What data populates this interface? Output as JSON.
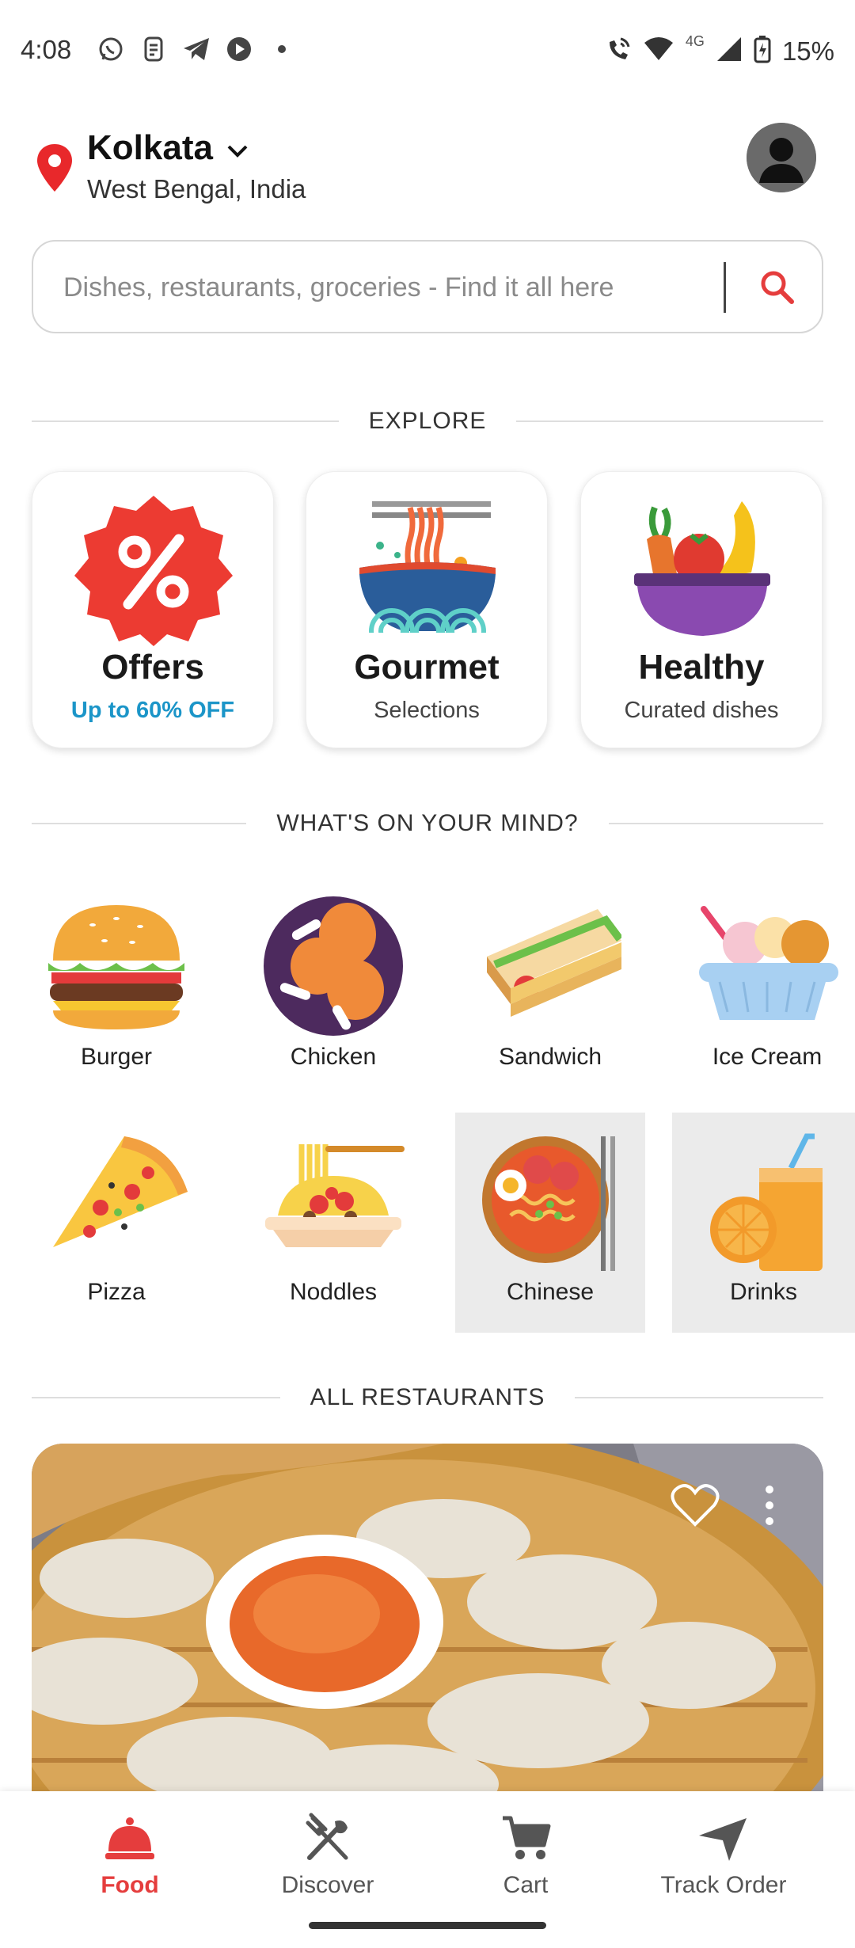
{
  "status_bar": {
    "time": "4:08",
    "network": "4G",
    "battery": "15%"
  },
  "header": {
    "city": "Kolkata",
    "region": "West Bengal, India"
  },
  "search": {
    "placeholder": "Dishes, restaurants, groceries - Find it all here"
  },
  "explore": {
    "heading": "EXPLORE",
    "cards": [
      {
        "title": "Offers",
        "subtitle": "Up to 60% OFF"
      },
      {
        "title": "Gourmet",
        "subtitle": "Selections"
      },
      {
        "title": "Healthy",
        "subtitle": "Curated dishes"
      }
    ]
  },
  "mind": {
    "heading": "WHAT'S ON YOUR MIND?",
    "categories": [
      {
        "label": "Burger"
      },
      {
        "label": "Chicken"
      },
      {
        "label": "Sandwich"
      },
      {
        "label": "Ice Cream"
      },
      {
        "label": "Pizza"
      },
      {
        "label": "Noddles"
      },
      {
        "label": "Chinese"
      },
      {
        "label": "Drinks"
      }
    ]
  },
  "restaurants": {
    "heading": "ALL RESTAURANTS"
  },
  "nav": {
    "items": [
      {
        "label": "Food",
        "active": true
      },
      {
        "label": "Discover"
      },
      {
        "label": "Cart"
      },
      {
        "label": "Track Order"
      }
    ]
  },
  "colors": {
    "accent_red": "#e53d3d",
    "offer_blue": "#1b95c8"
  }
}
